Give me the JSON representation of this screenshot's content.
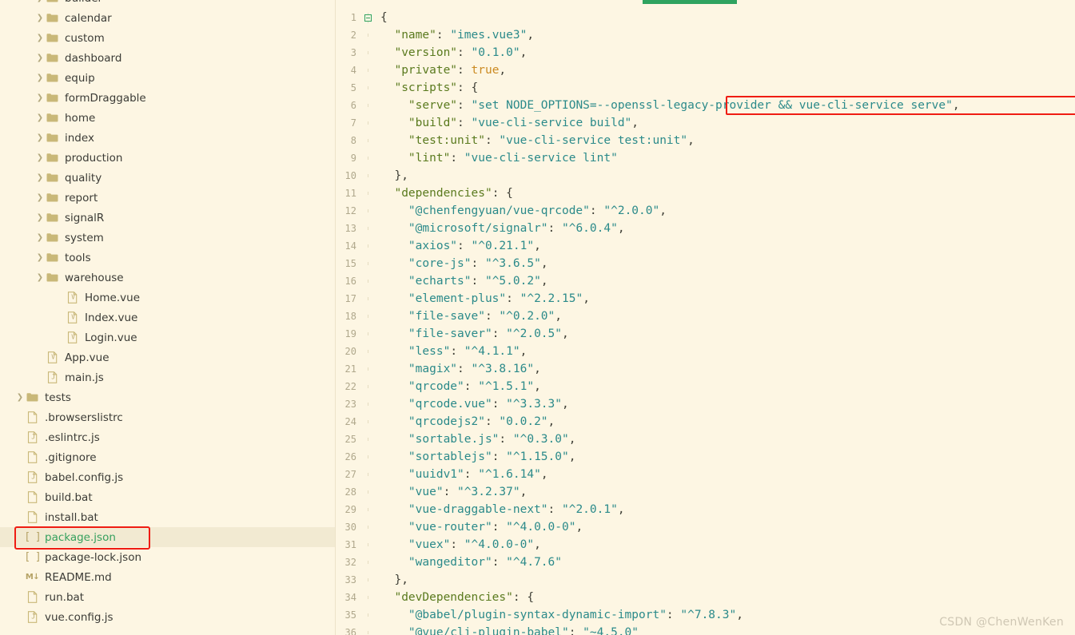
{
  "window": {
    "watermark": "CSDN @ChenWenKen",
    "accent_green": "#2fa360",
    "annotation_red": "#ef1c13",
    "background": "#fdf6e3",
    "selected_row_bg": "#f2ead2"
  },
  "sidebar": {
    "name": "file-explorer",
    "selected_file": "package.json",
    "items": [
      {
        "label": "builder",
        "type": "folder",
        "depth": 2,
        "expandable": true,
        "clipped": true
      },
      {
        "label": "calendar",
        "type": "folder",
        "depth": 2,
        "expandable": true
      },
      {
        "label": "custom",
        "type": "folder",
        "depth": 2,
        "expandable": true
      },
      {
        "label": "dashboard",
        "type": "folder",
        "depth": 2,
        "expandable": true
      },
      {
        "label": "equip",
        "type": "folder",
        "depth": 2,
        "expandable": true
      },
      {
        "label": "formDraggable",
        "type": "folder",
        "depth": 2,
        "expandable": true
      },
      {
        "label": "home",
        "type": "folder",
        "depth": 2,
        "expandable": true
      },
      {
        "label": "index",
        "type": "folder",
        "depth": 2,
        "expandable": true
      },
      {
        "label": "production",
        "type": "folder",
        "depth": 2,
        "expandable": true
      },
      {
        "label": "quality",
        "type": "folder",
        "depth": 2,
        "expandable": true
      },
      {
        "label": "report",
        "type": "folder",
        "depth": 2,
        "expandable": true
      },
      {
        "label": "signalR",
        "type": "folder",
        "depth": 2,
        "expandable": true
      },
      {
        "label": "system",
        "type": "folder",
        "depth": 2,
        "expandable": true
      },
      {
        "label": "tools",
        "type": "folder",
        "depth": 2,
        "expandable": true
      },
      {
        "label": "warehouse",
        "type": "folder",
        "depth": 2,
        "expandable": true
      },
      {
        "label": "Home.vue",
        "type": "vue",
        "depth": 3
      },
      {
        "label": "Index.vue",
        "type": "vue",
        "depth": 3
      },
      {
        "label": "Login.vue",
        "type": "vue",
        "depth": 3
      },
      {
        "label": "App.vue",
        "type": "vue",
        "depth": 2
      },
      {
        "label": "main.js",
        "type": "js",
        "depth": 2
      },
      {
        "label": "tests",
        "type": "folder",
        "depth": 1,
        "expandable": true
      },
      {
        "label": ".browserslistrc",
        "type": "file",
        "depth": 1
      },
      {
        "label": ".eslintrc.js",
        "type": "js",
        "depth": 1
      },
      {
        "label": ".gitignore",
        "type": "file",
        "depth": 1
      },
      {
        "label": "babel.config.js",
        "type": "js",
        "depth": 1
      },
      {
        "label": "build.bat",
        "type": "file",
        "depth": 1
      },
      {
        "label": "install.bat",
        "type": "file",
        "depth": 1
      },
      {
        "label": "package.json",
        "type": "json",
        "depth": 1,
        "selected": true,
        "annotated": true
      },
      {
        "label": "package-lock.json",
        "type": "json",
        "depth": 1
      },
      {
        "label": "README.md",
        "type": "md",
        "depth": 1
      },
      {
        "label": "run.bat",
        "type": "file",
        "depth": 1
      },
      {
        "label": "vue.config.js",
        "type": "js",
        "depth": 1
      }
    ],
    "icon_glyphs": {
      "folder": "folder-icon",
      "file": "file-icon",
      "js": "javascript-file-icon",
      "vue": "vue-file-icon",
      "json": "json-file-icon",
      "md": "markdown-file-icon",
      "twisty": "chevron-right-icon"
    }
  },
  "editor": {
    "name": "code-editor",
    "file": "package.json",
    "language": "json",
    "annotated_line": 6,
    "folded_line": 1,
    "lines": [
      {
        "n": 1,
        "fold": true,
        "tokens": [
          {
            "t": "punc",
            "v": "{"
          }
        ]
      },
      {
        "n": 2,
        "tokens": [
          {
            "t": "key",
            "v": "  \"name\""
          },
          {
            "t": "punc",
            "v": ": "
          },
          {
            "t": "str",
            "v": "\"imes.vue3\""
          },
          {
            "t": "punc",
            "v": ","
          }
        ]
      },
      {
        "n": 3,
        "tokens": [
          {
            "t": "key",
            "v": "  \"version\""
          },
          {
            "t": "punc",
            "v": ": "
          },
          {
            "t": "str",
            "v": "\"0.1.0\""
          },
          {
            "t": "punc",
            "v": ","
          }
        ]
      },
      {
        "n": 4,
        "tokens": [
          {
            "t": "key",
            "v": "  \"private\""
          },
          {
            "t": "punc",
            "v": ": "
          },
          {
            "t": "bool",
            "v": "true"
          },
          {
            "t": "punc",
            "v": ","
          }
        ]
      },
      {
        "n": 5,
        "tokens": [
          {
            "t": "key",
            "v": "  \"scripts\""
          },
          {
            "t": "punc",
            "v": ": "
          },
          {
            "t": "punc",
            "v": "{"
          }
        ]
      },
      {
        "n": 6,
        "annot": true,
        "tokens": [
          {
            "t": "key",
            "v": "    \"serve\""
          },
          {
            "t": "punc",
            "v": ": "
          },
          {
            "t": "str",
            "v": "\"set NODE_OPTIONS=--openssl-legacy-provider && vue-cli-service serve\""
          },
          {
            "t": "punc",
            "v": ","
          }
        ]
      },
      {
        "n": 7,
        "tokens": [
          {
            "t": "key",
            "v": "    \"build\""
          },
          {
            "t": "punc",
            "v": ": "
          },
          {
            "t": "str",
            "v": "\"vue-cli-service build\""
          },
          {
            "t": "punc",
            "v": ","
          }
        ]
      },
      {
        "n": 8,
        "tokens": [
          {
            "t": "key",
            "v": "    \"test:unit\""
          },
          {
            "t": "punc",
            "v": ": "
          },
          {
            "t": "str",
            "v": "\"vue-cli-service test:unit\""
          },
          {
            "t": "punc",
            "v": ","
          }
        ]
      },
      {
        "n": 9,
        "tokens": [
          {
            "t": "key",
            "v": "    \"lint\""
          },
          {
            "t": "punc",
            "v": ": "
          },
          {
            "t": "str",
            "v": "\"vue-cli-service lint\""
          }
        ]
      },
      {
        "n": 10,
        "tokens": [
          {
            "t": "punc",
            "v": "  },"
          }
        ]
      },
      {
        "n": 11,
        "tokens": [
          {
            "t": "key",
            "v": "  \"dependencies\""
          },
          {
            "t": "punc",
            "v": ": "
          },
          {
            "t": "punc",
            "v": "{"
          }
        ]
      },
      {
        "n": 12,
        "tokens": [
          {
            "t": "dep",
            "v": "    \"@chenfengyuan/vue-qrcode\""
          },
          {
            "t": "punc",
            "v": ": "
          },
          {
            "t": "dep",
            "v": "\"^2.0.0\""
          },
          {
            "t": "punc",
            "v": ","
          }
        ]
      },
      {
        "n": 13,
        "tokens": [
          {
            "t": "dep",
            "v": "    \"@microsoft/signalr\""
          },
          {
            "t": "punc",
            "v": ": "
          },
          {
            "t": "dep",
            "v": "\"^6.0.4\""
          },
          {
            "t": "punc",
            "v": ","
          }
        ]
      },
      {
        "n": 14,
        "tokens": [
          {
            "t": "dep",
            "v": "    \"axios\""
          },
          {
            "t": "punc",
            "v": ": "
          },
          {
            "t": "dep",
            "v": "\"^0.21.1\""
          },
          {
            "t": "punc",
            "v": ","
          }
        ]
      },
      {
        "n": 15,
        "tokens": [
          {
            "t": "dep",
            "v": "    \"core-js\""
          },
          {
            "t": "punc",
            "v": ": "
          },
          {
            "t": "dep",
            "v": "\"^3.6.5\""
          },
          {
            "t": "punc",
            "v": ","
          }
        ]
      },
      {
        "n": 16,
        "tokens": [
          {
            "t": "dep",
            "v": "    \"echarts\""
          },
          {
            "t": "punc",
            "v": ": "
          },
          {
            "t": "dep",
            "v": "\"^5.0.2\""
          },
          {
            "t": "punc",
            "v": ","
          }
        ]
      },
      {
        "n": 17,
        "tokens": [
          {
            "t": "dep",
            "v": "    \"element-plus\""
          },
          {
            "t": "punc",
            "v": ": "
          },
          {
            "t": "dep",
            "v": "\"^2.2.15\""
          },
          {
            "t": "punc",
            "v": ","
          }
        ]
      },
      {
        "n": 18,
        "tokens": [
          {
            "t": "dep",
            "v": "    \"file-save\""
          },
          {
            "t": "punc",
            "v": ": "
          },
          {
            "t": "dep",
            "v": "\"^0.2.0\""
          },
          {
            "t": "punc",
            "v": ","
          }
        ]
      },
      {
        "n": 19,
        "tokens": [
          {
            "t": "dep",
            "v": "    \"file-saver\""
          },
          {
            "t": "punc",
            "v": ": "
          },
          {
            "t": "dep",
            "v": "\"^2.0.5\""
          },
          {
            "t": "punc",
            "v": ","
          }
        ]
      },
      {
        "n": 20,
        "tokens": [
          {
            "t": "dep",
            "v": "    \"less\""
          },
          {
            "t": "punc",
            "v": ": "
          },
          {
            "t": "dep",
            "v": "\"^4.1.1\""
          },
          {
            "t": "punc",
            "v": ","
          }
        ]
      },
      {
        "n": 21,
        "tokens": [
          {
            "t": "dep",
            "v": "    \"magix\""
          },
          {
            "t": "punc",
            "v": ": "
          },
          {
            "t": "dep",
            "v": "\"^3.8.16\""
          },
          {
            "t": "punc",
            "v": ","
          }
        ]
      },
      {
        "n": 22,
        "tokens": [
          {
            "t": "dep",
            "v": "    \"qrcode\""
          },
          {
            "t": "punc",
            "v": ": "
          },
          {
            "t": "dep",
            "v": "\"^1.5.1\""
          },
          {
            "t": "punc",
            "v": ","
          }
        ]
      },
      {
        "n": 23,
        "tokens": [
          {
            "t": "dep",
            "v": "    \"qrcode.vue\""
          },
          {
            "t": "punc",
            "v": ": "
          },
          {
            "t": "dep",
            "v": "\"^3.3.3\""
          },
          {
            "t": "punc",
            "v": ","
          }
        ]
      },
      {
        "n": 24,
        "tokens": [
          {
            "t": "dep",
            "v": "    \"qrcodejs2\""
          },
          {
            "t": "punc",
            "v": ": "
          },
          {
            "t": "dep",
            "v": "\"0.0.2\""
          },
          {
            "t": "punc",
            "v": ","
          }
        ]
      },
      {
        "n": 25,
        "tokens": [
          {
            "t": "dep",
            "v": "    \"sortable.js\""
          },
          {
            "t": "punc",
            "v": ": "
          },
          {
            "t": "dep",
            "v": "\"^0.3.0\""
          },
          {
            "t": "punc",
            "v": ","
          }
        ]
      },
      {
        "n": 26,
        "tokens": [
          {
            "t": "dep",
            "v": "    \"sortablejs\""
          },
          {
            "t": "punc",
            "v": ": "
          },
          {
            "t": "dep",
            "v": "\"^1.15.0\""
          },
          {
            "t": "punc",
            "v": ","
          }
        ]
      },
      {
        "n": 27,
        "tokens": [
          {
            "t": "dep",
            "v": "    \"uuidv1\""
          },
          {
            "t": "punc",
            "v": ": "
          },
          {
            "t": "dep",
            "v": "\"^1.6.14\""
          },
          {
            "t": "punc",
            "v": ","
          }
        ]
      },
      {
        "n": 28,
        "tokens": [
          {
            "t": "dep",
            "v": "    \"vue\""
          },
          {
            "t": "punc",
            "v": ": "
          },
          {
            "t": "dep",
            "v": "\"^3.2.37\""
          },
          {
            "t": "punc",
            "v": ","
          }
        ]
      },
      {
        "n": 29,
        "tokens": [
          {
            "t": "dep",
            "v": "    \"vue-draggable-next\""
          },
          {
            "t": "punc",
            "v": ": "
          },
          {
            "t": "dep",
            "v": "\"^2.0.1\""
          },
          {
            "t": "punc",
            "v": ","
          }
        ]
      },
      {
        "n": 30,
        "tokens": [
          {
            "t": "dep",
            "v": "    \"vue-router\""
          },
          {
            "t": "punc",
            "v": ": "
          },
          {
            "t": "dep",
            "v": "\"^4.0.0-0\""
          },
          {
            "t": "punc",
            "v": ","
          }
        ]
      },
      {
        "n": 31,
        "tokens": [
          {
            "t": "dep",
            "v": "    \"vuex\""
          },
          {
            "t": "punc",
            "v": ": "
          },
          {
            "t": "dep",
            "v": "\"^4.0.0-0\""
          },
          {
            "t": "punc",
            "v": ","
          }
        ]
      },
      {
        "n": 32,
        "tokens": [
          {
            "t": "dep",
            "v": "    \"wangeditor\""
          },
          {
            "t": "punc",
            "v": ": "
          },
          {
            "t": "dep",
            "v": "\"^4.7.6\""
          }
        ]
      },
      {
        "n": 33,
        "tokens": [
          {
            "t": "punc",
            "v": "  },"
          }
        ]
      },
      {
        "n": 34,
        "tokens": [
          {
            "t": "key",
            "v": "  \"devDependencies\""
          },
          {
            "t": "punc",
            "v": ": "
          },
          {
            "t": "punc",
            "v": "{"
          }
        ]
      },
      {
        "n": 35,
        "tokens": [
          {
            "t": "dep",
            "v": "    \"@babel/plugin-syntax-dynamic-import\""
          },
          {
            "t": "punc",
            "v": ": "
          },
          {
            "t": "dep",
            "v": "\"^7.8.3\""
          },
          {
            "t": "punc",
            "v": ","
          }
        ]
      },
      {
        "n": 36,
        "tokens": [
          {
            "t": "dep",
            "v": "    \"@vue/cli-plugin-babel\""
          },
          {
            "t": "punc",
            "v": ": "
          },
          {
            "t": "dep",
            "v": "\"~4.5.0\""
          }
        ]
      }
    ]
  }
}
